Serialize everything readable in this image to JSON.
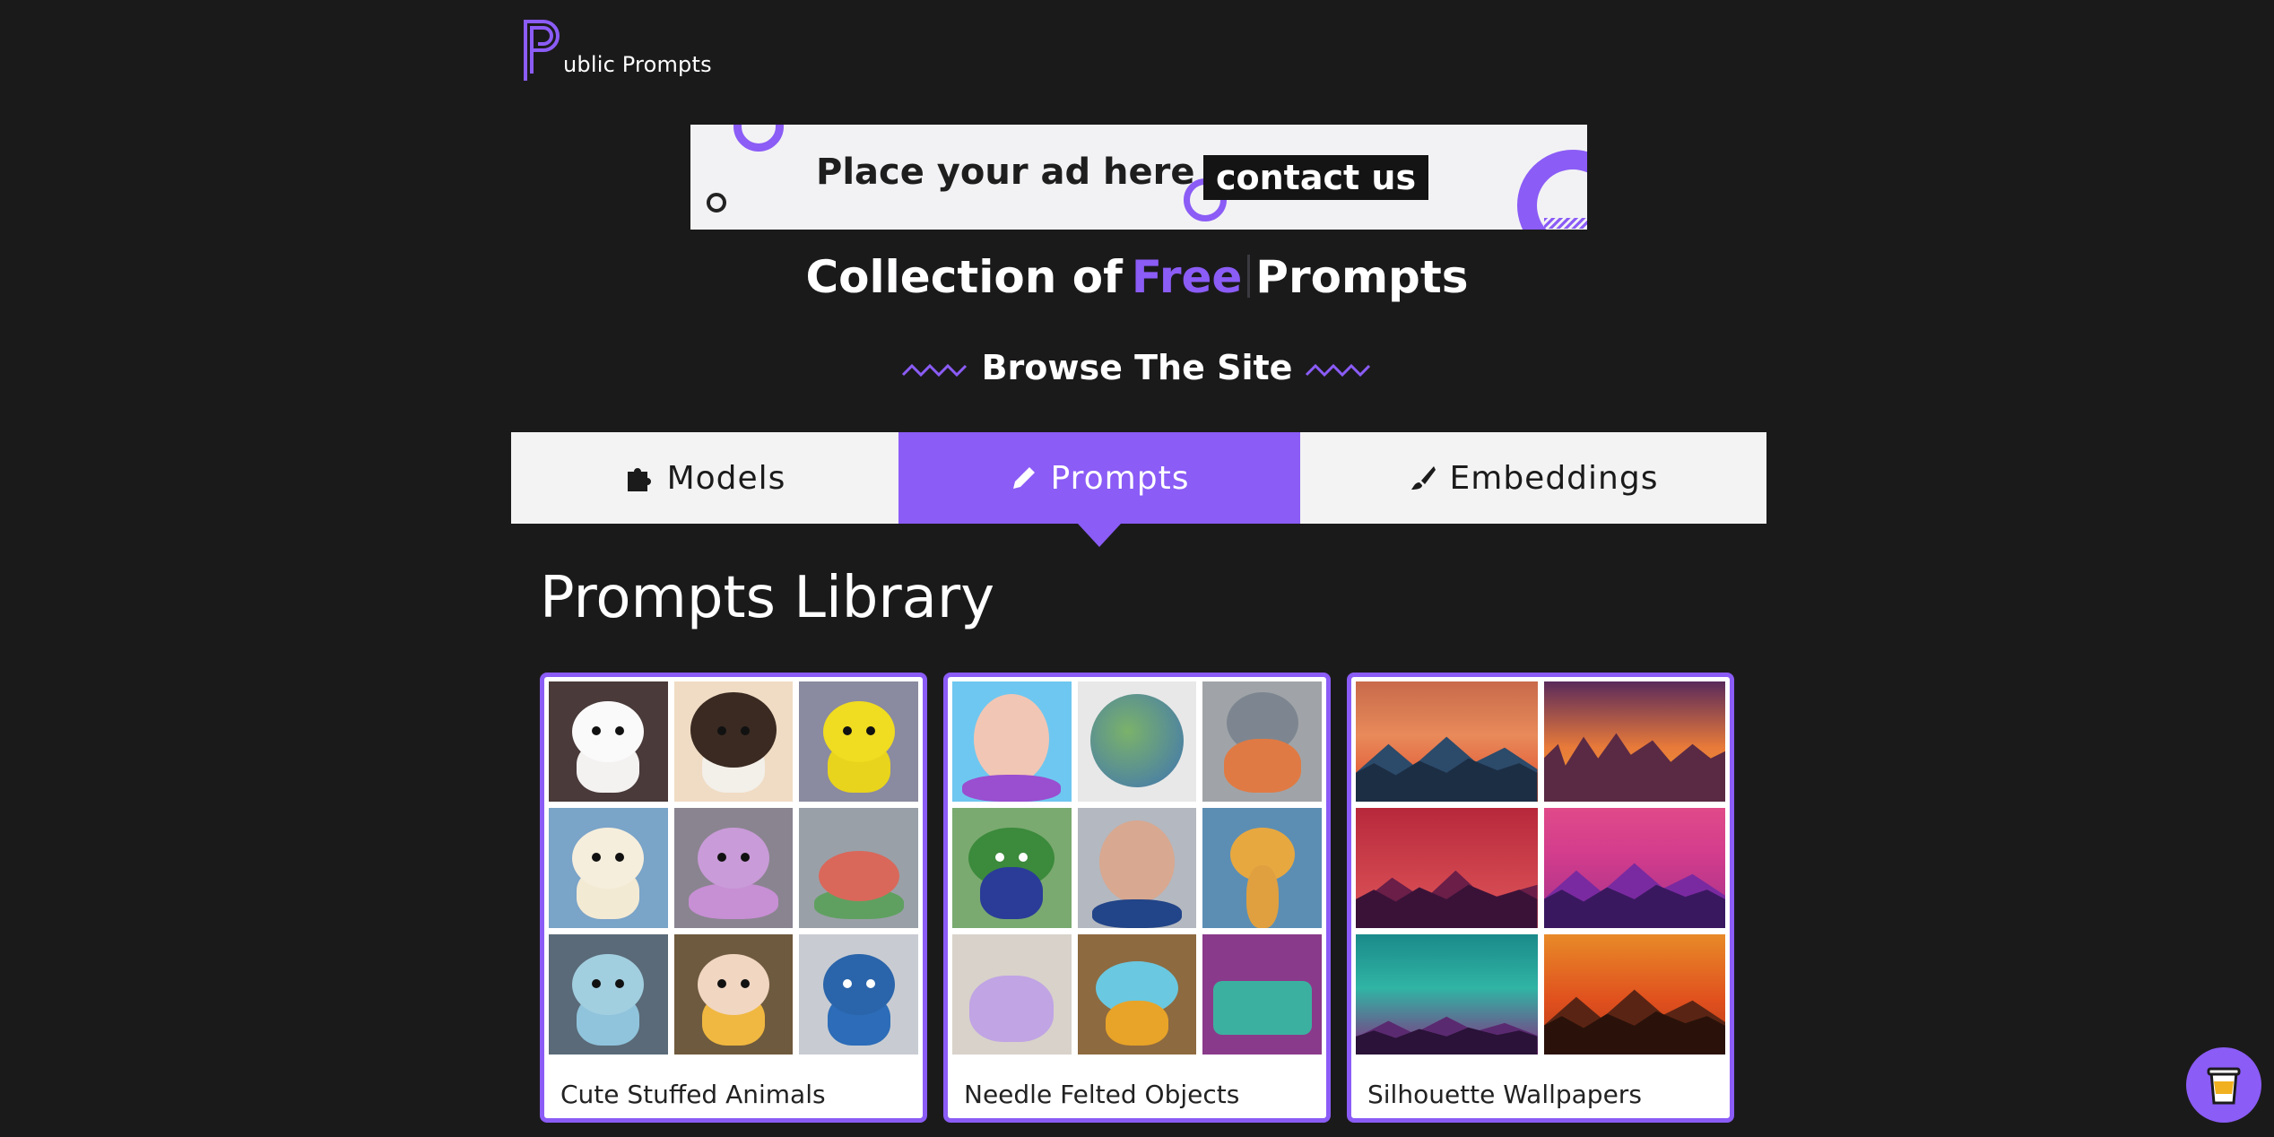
{
  "brand": {
    "logo_letter": "P",
    "name": "ublic Prompts"
  },
  "ad": {
    "text": "Place your ad here",
    "cta": "contact us"
  },
  "hero": {
    "prefix": "Collection of",
    "accent": "Free",
    "suffix": "Prompts"
  },
  "browse": {
    "title": "Browse The Site"
  },
  "tabs": [
    {
      "label": "Models",
      "icon": "puzzle-icon",
      "active": false
    },
    {
      "label": "Prompts",
      "icon": "pencil-icon",
      "active": true
    },
    {
      "label": "Embeddings",
      "icon": "brush-icon",
      "active": false
    }
  ],
  "library": {
    "title": "Prompts Library",
    "cards": [
      {
        "label": "Cute Stuffed Animals"
      },
      {
        "label": "Needle Felted Objects"
      },
      {
        "label": "Silhouette Wallpapers"
      }
    ]
  },
  "floating": {
    "icon": "coffee-cup-icon"
  },
  "colors": {
    "accent": "#8b5cf6",
    "background": "#1b1a1b",
    "tab_bg": "#f3f3f3"
  }
}
